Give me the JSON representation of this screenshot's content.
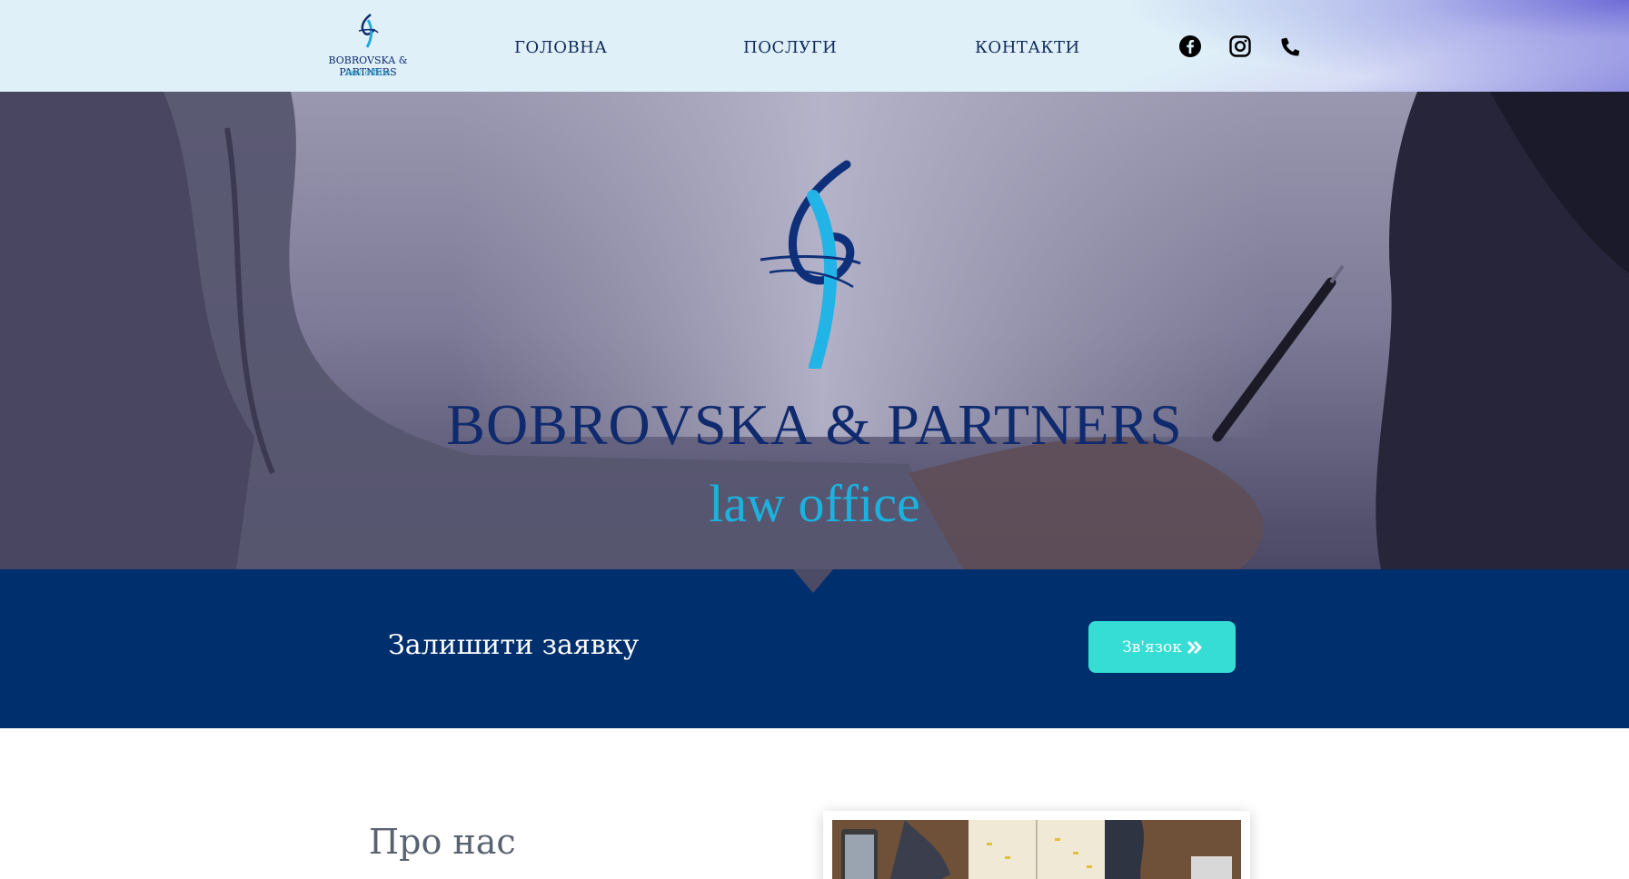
{
  "header": {
    "logo_brand": "BOBROVSKA & PARTNERS",
    "logo_sub": "law office",
    "nav": [
      "ГОЛОВНА",
      "ПОСЛУГИ",
      "КОНТАКТИ"
    ],
    "social_icons": [
      "facebook-icon",
      "instagram-icon",
      "phone-icon"
    ]
  },
  "hero": {
    "title": "BOBROVSKA & PARTNERS",
    "subtitle": "law office"
  },
  "cta": {
    "text": "Залишити заявку",
    "button_label": "Зв'язок",
    "button_icon": "double-chevron-right-icon"
  },
  "about": {
    "title": "Про нас"
  },
  "colors": {
    "navy": "#002f6e",
    "accent_cyan": "#1bb2e0",
    "button_teal": "#35ddd4",
    "header_bg": "#dff0f8"
  }
}
